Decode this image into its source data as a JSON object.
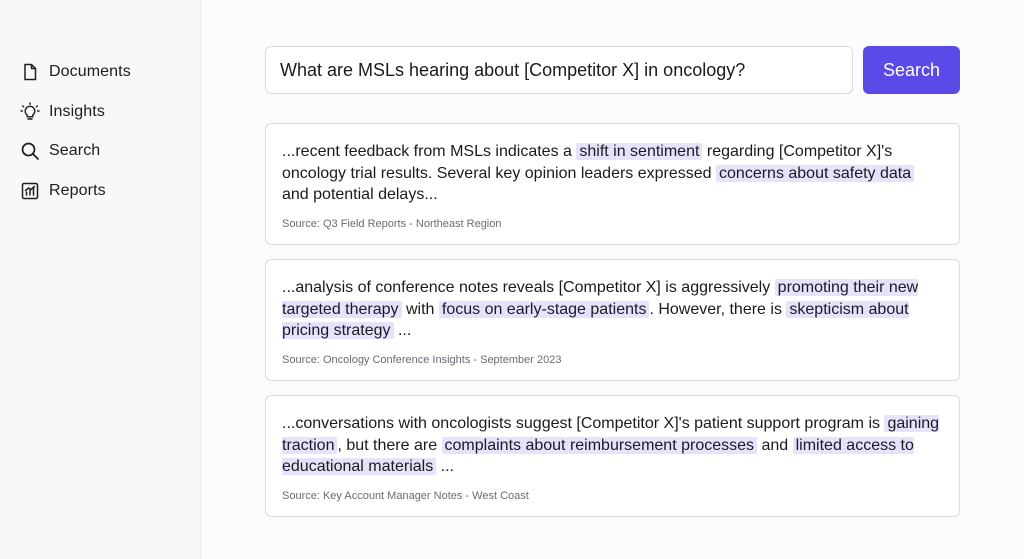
{
  "sidebar": {
    "items": [
      {
        "label": "Documents",
        "icon": "document-icon"
      },
      {
        "label": "Insights",
        "icon": "lightbulb-icon"
      },
      {
        "label": "Search",
        "icon": "search-icon"
      },
      {
        "label": "Reports",
        "icon": "chart-icon"
      }
    ]
  },
  "search": {
    "query": "What are MSLs hearing about [Competitor X] in oncology?",
    "button_label": "Search"
  },
  "colors": {
    "accent": "#5a4be8",
    "highlight": "#e7e1fb"
  },
  "results": [
    {
      "segments": [
        {
          "text": "...recent feedback from MSLs indicates a ",
          "hl": false
        },
        {
          "text": "shift in sentiment",
          "hl": true
        },
        {
          "text": " regarding [Competitor X]'s oncology trial results. Several key opinion leaders expressed ",
          "hl": false
        },
        {
          "text": "concerns about safety data",
          "hl": true
        },
        {
          "text": " and potential delays...",
          "hl": false
        }
      ],
      "source": "Source: Q3 Field Reports - Northeast Region"
    },
    {
      "segments": [
        {
          "text": "...analysis of conference notes reveals [Competitor X] is aggressively ",
          "hl": false
        },
        {
          "text": "promoting their new targeted therapy",
          "hl": true
        },
        {
          "text": " with ",
          "hl": false
        },
        {
          "text": "focus on early-stage patients",
          "hl": true
        },
        {
          "text": ". However, there is ",
          "hl": false
        },
        {
          "text": "skepticism about pricing strategy",
          "hl": true
        },
        {
          "text": " ...",
          "hl": false
        }
      ],
      "source": "Source: Oncology Conference Insights - September 2023"
    },
    {
      "segments": [
        {
          "text": "...conversations with oncologists suggest [Competitor X]'s patient support program is ",
          "hl": false
        },
        {
          "text": "gaining traction",
          "hl": true
        },
        {
          "text": ", but there are ",
          "hl": false
        },
        {
          "text": "complaints about reimbursement processes",
          "hl": true
        },
        {
          "text": " and ",
          "hl": false
        },
        {
          "text": "limited access to educational materials",
          "hl": true
        },
        {
          "text": " ...",
          "hl": false
        }
      ],
      "source": "Source: Key Account Manager Notes - West Coast"
    }
  ]
}
